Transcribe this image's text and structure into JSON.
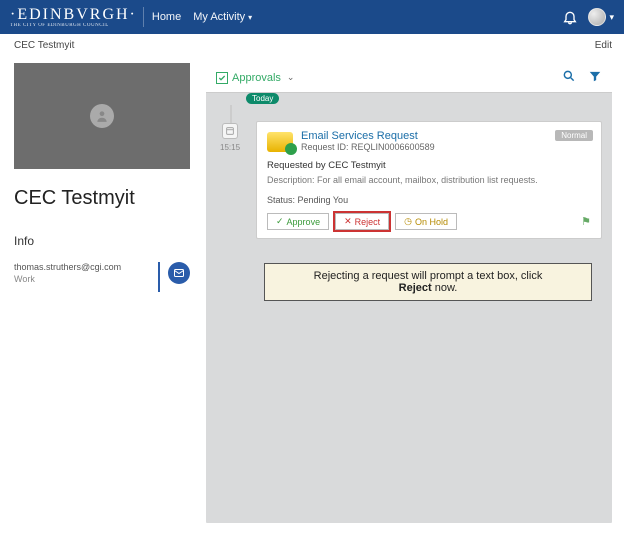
{
  "navbar": {
    "brand": "·EDINBVRGH·",
    "brand_sub": "THE CITY OF EDINBURGH COUNCIL",
    "home": "Home",
    "my_activity": "My Activity"
  },
  "breadcrumb": "CEC Testmyit",
  "edit": "Edit",
  "profile": {
    "name": "CEC Testmyit",
    "info_header": "Info",
    "email": "thomas.struthers@cgi.com",
    "email_label": "Work"
  },
  "approvals": {
    "label": "Approvals"
  },
  "timeline": {
    "today": "Today",
    "time": "15:15"
  },
  "card": {
    "badge": "Normal",
    "title": "Email Services Request",
    "id_label": "Request ID: REQLIN0006600589",
    "requested_by": "Requested by CEC Testmyit",
    "description": "Description: For all email account, mailbox, distribution list requests.",
    "status": "Status: Pending     You",
    "approve": "Approve",
    "reject": "Reject",
    "hold": "On Hold"
  },
  "callout": {
    "line1": "Rejecting a request will prompt a text box, click",
    "bold": "Reject",
    "line2": " now."
  }
}
